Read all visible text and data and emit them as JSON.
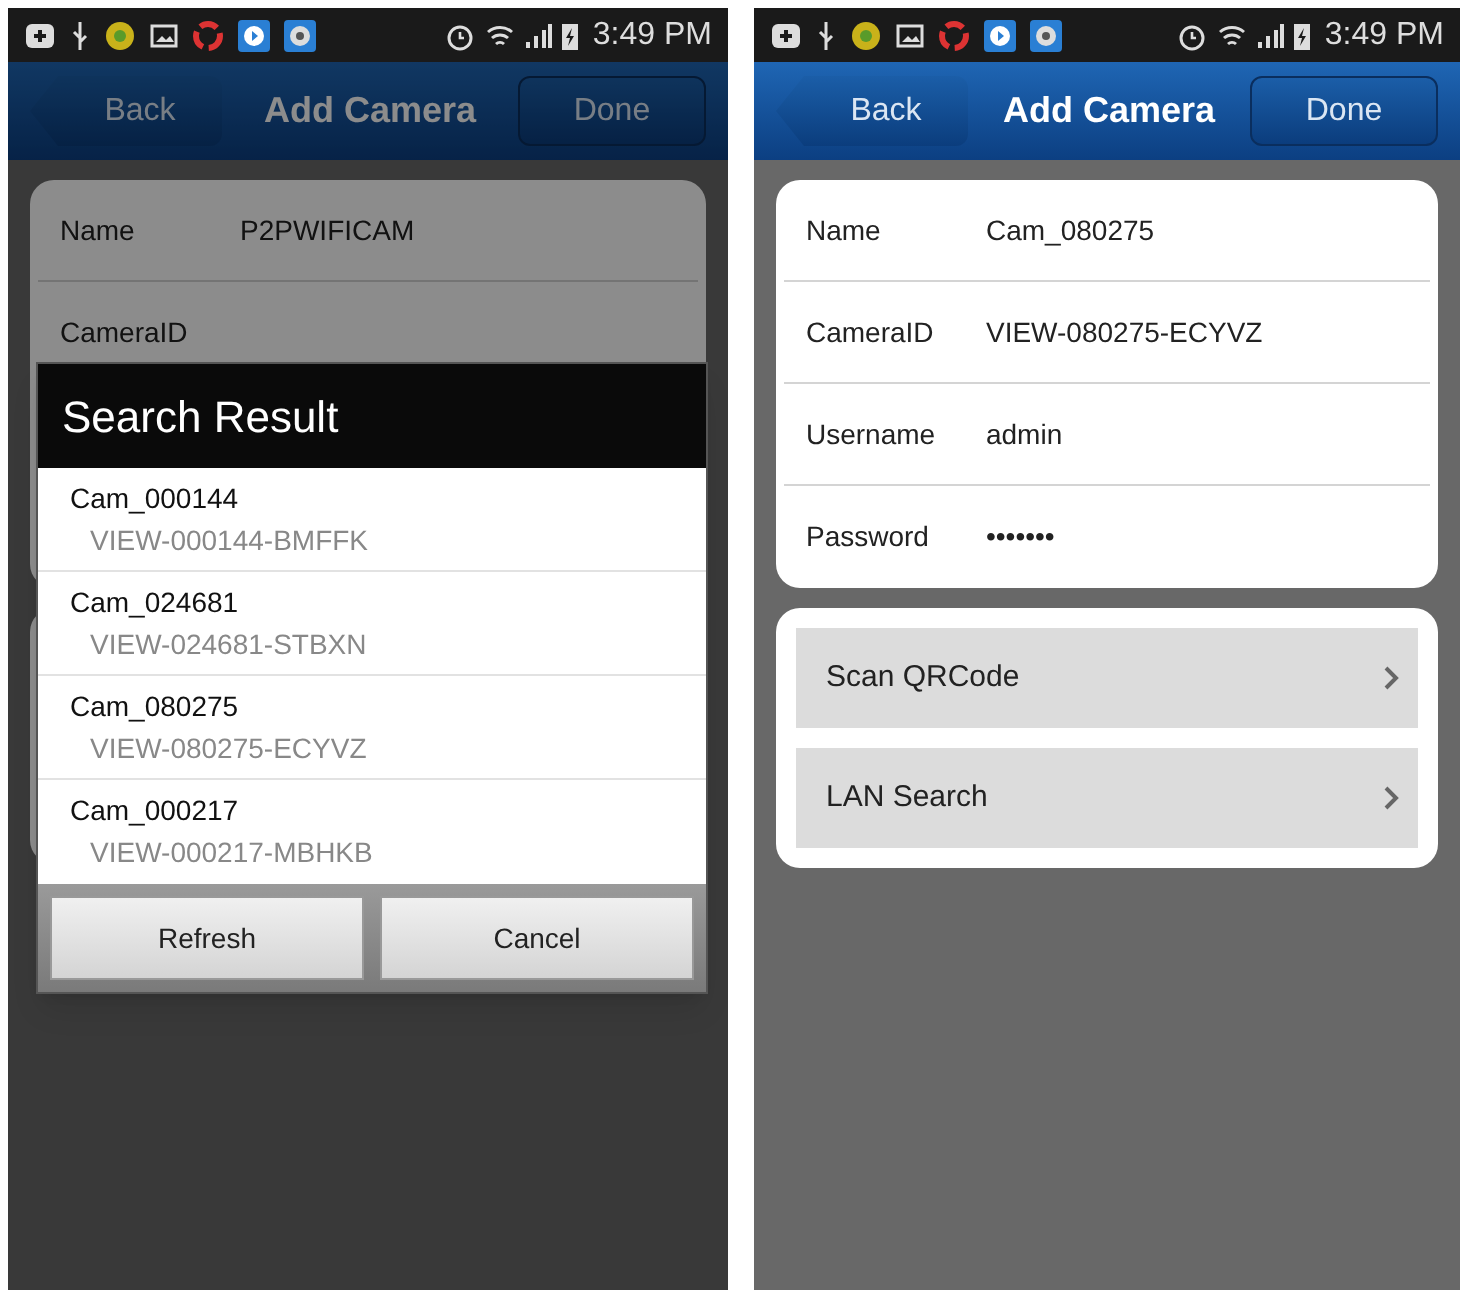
{
  "screens": [
    {
      "status_bar": {
        "time": "3:49 PM"
      },
      "header": {
        "back": "Back",
        "title": "Add Camera",
        "done": "Done"
      },
      "dimmed": true,
      "form": [
        {
          "label": "Name",
          "value": "P2PWIFICAM"
        },
        {
          "label": "CameraID"
        }
      ],
      "dialog": {
        "title": "Search Result",
        "results": [
          {
            "name": "Cam_000144",
            "id": "VIEW-000144-BMFFK"
          },
          {
            "name": "Cam_024681",
            "id": "VIEW-024681-STBXN"
          },
          {
            "name": "Cam_080275",
            "id": "VIEW-080275-ECYVZ"
          },
          {
            "name": "Cam_000217",
            "id": "VIEW-000217-MBHKB"
          }
        ],
        "buttons": [
          "Refresh",
          "Cancel"
        ]
      }
    },
    {
      "status_bar": {
        "time": "3:49 PM"
      },
      "header": {
        "back": "Back",
        "title": "Add Camera",
        "done": "Done"
      },
      "dimmed": false,
      "form": [
        {
          "label": "Name",
          "value": "Cam_080275"
        },
        {
          "label": "CameraID",
          "value": "VIEW-080275-ECYVZ"
        },
        {
          "label": "Username",
          "value": "admin"
        },
        {
          "label": "Password",
          "value": "•••••••"
        }
      ],
      "actions": [
        "Scan QRCode",
        "LAN Search"
      ]
    }
  ]
}
